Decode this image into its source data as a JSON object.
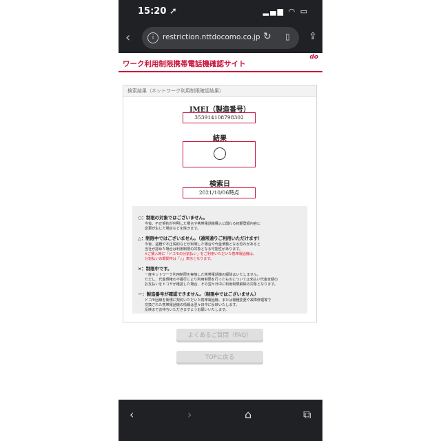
{
  "status_bar": {
    "time": "15:20 ➚",
    "indicators": "▂▄▆ ◠ ▭"
  },
  "browser": {
    "back_icon": "chevron-left-icon",
    "url": "restriction.nttdocomo.co.jp",
    "reload_glyph": "↻",
    "bookmark_glyph": "▯",
    "share_glyph": "⇪"
  },
  "site": {
    "title": "ワーク利用制限携帯電話機確認サイト",
    "logo": "do",
    "accent_color": "#c8143c"
  },
  "panel": {
    "heading": "検索結果（ネットワーク利用制限確認結果）",
    "imei_label": "IMEI（製造番号）",
    "imei_value": "353914108798302",
    "result_label": "結果",
    "date_label": "検索日",
    "date_value": "2021/10/06時点"
  },
  "legend": {
    "circle_head": "○：制限の対象ではございません。",
    "circle_l1": "今後、不正契約が判明した場合や携帯電話機購入に関わる初期登録内容に",
    "circle_l2": "変更が生じた場合などを除きます。",
    "triangle_head": "△：制限中ではございません。（通常通りご利用いただけます）",
    "triangle_l1": "今後、盗難や不正契約などが判明した場合や代金債務となる恐れがあると",
    "triangle_l2": "当社が認めた場合は利用制限の対象となる可能性があります。",
    "triangle_r1": "※ご購入時に「ドコモの分割払い」をご利用いただいた携帯電話機は、",
    "triangle_r2": "分割払いの期間中は「△」表示となります。",
    "cross_head": "×：制限中です。",
    "cross_l1": "一度ネットワーク利用制限を実施した携帯電話機の解除はいたしません。",
    "cross_l2": "ただし、代金債権の不履行により利用制限を行ったものについては未払い代金全額の",
    "cross_l3": "お支払いをドコモが確認した場合、その翌々日中に利用制限解除の対象となります。",
    "dash_head": "－：製造番号が確認できません。（制限中ではございません）",
    "dash_l1": "ドコモ回線を新規に契約いただいた携帯電話機、または機種変更や故障修理等で",
    "dash_l2": "交換された携帯電話機の情報は翌々日中に反映いたします。",
    "dash_l3": "反映までお待ちいただきますようお願いいたします。"
  },
  "buttons": {
    "faq": "よくあるご質問（FAQ）",
    "top": "TOPに戻る"
  },
  "bottom_nav": {
    "back": "‹",
    "forward": "›",
    "home": "⌂",
    "tabs": "⧉"
  }
}
